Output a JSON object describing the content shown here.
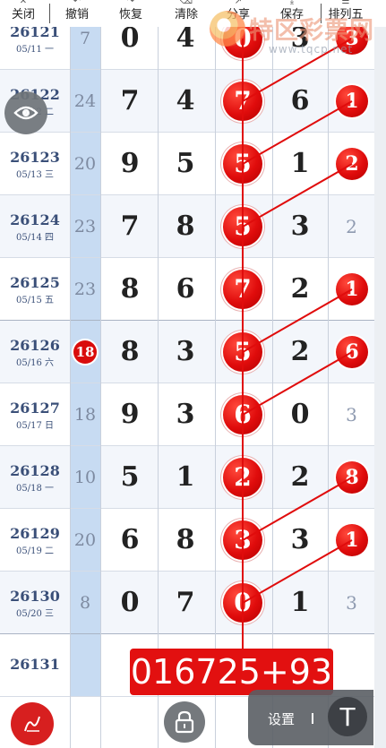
{
  "toolbar": {
    "items": [
      {
        "label": "关闭",
        "icon": "close-icon"
      },
      {
        "label": "撤销",
        "icon": "undo-icon"
      },
      {
        "label": "恢复",
        "icon": "redo-icon"
      },
      {
        "label": "清除",
        "icon": "clear-icon"
      },
      {
        "label": "分享",
        "icon": "share-icon"
      },
      {
        "label": "保存",
        "icon": "save-icon"
      },
      {
        "label": "排列五",
        "icon": "lottery-icon"
      }
    ]
  },
  "watermark": {
    "name": "特区彩票网",
    "url": "www.tqcp.net"
  },
  "rows": [
    {
      "issue": "26121",
      "date": "05/11 一",
      "sum": "7",
      "d": [
        "0",
        "4",
        "0",
        "3",
        "3"
      ],
      "sum_ball": false
    },
    {
      "issue": "26122",
      "date": "05/12 二",
      "sum": "24",
      "d": [
        "7",
        "4",
        "7",
        "6",
        "1"
      ],
      "sum_ball": false
    },
    {
      "issue": "26123",
      "date": "05/13 三",
      "sum": "20",
      "d": [
        "9",
        "5",
        "5",
        "1",
        "2"
      ],
      "sum_ball": false
    },
    {
      "issue": "26124",
      "date": "05/14 四",
      "sum": "23",
      "d": [
        "7",
        "8",
        "5",
        "3",
        "2"
      ],
      "sum_ball": false
    },
    {
      "issue": "26125",
      "date": "05/15 五",
      "sum": "23",
      "d": [
        "8",
        "6",
        "7",
        "2",
        "1"
      ],
      "sum_ball": false
    },
    {
      "issue": "26126",
      "date": "05/16 六",
      "sum": "18",
      "d": [
        "8",
        "3",
        "5",
        "2",
        "6"
      ],
      "sum_ball": true
    },
    {
      "issue": "26127",
      "date": "05/17 日",
      "sum": "18",
      "d": [
        "9",
        "3",
        "6",
        "0",
        "3"
      ],
      "sum_ball": false
    },
    {
      "issue": "26128",
      "date": "05/18 一",
      "sum": "10",
      "d": [
        "5",
        "1",
        "2",
        "2",
        "8"
      ],
      "sum_ball": false
    },
    {
      "issue": "26129",
      "date": "05/19 二",
      "sum": "20",
      "d": [
        "6",
        "8",
        "3",
        "3",
        "1"
      ],
      "sum_ball": false
    },
    {
      "issue": "26130",
      "date": "05/20 三",
      "sum": "8",
      "d": [
        "0",
        "7",
        "0",
        "1",
        "3"
      ],
      "sum_ball": false
    }
  ],
  "next_issue": "26131",
  "marked": {
    "col3": [
      true,
      true,
      true,
      true,
      true,
      true,
      true,
      true,
      true,
      true
    ],
    "col5": [
      true,
      true,
      true,
      false,
      true,
      true,
      false,
      true,
      true,
      false
    ]
  },
  "result_text": "016725+93",
  "settings_label": "设置",
  "top_button_label": "T",
  "colors": {
    "ball": "#e00c0c",
    "sum_column": "#c7dbf2",
    "issue_text": "#3a4f78"
  }
}
